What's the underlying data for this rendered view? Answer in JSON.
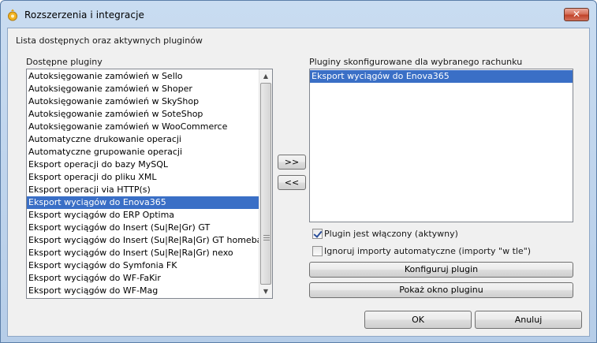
{
  "window": {
    "title": "Rozszerzenia i integracje",
    "close_symbol": "✕"
  },
  "header": {
    "description": "Lista dostępnych oraz aktywnych pluginów"
  },
  "available": {
    "label": "Dostępne pluginy",
    "items": [
      "Autoksięgowanie zamówień w Sello",
      "Autoksięgowanie zamówień w Shoper",
      "Autoksięgowanie zamówień w SkyShop",
      "Autoksięgowanie zamówień w SoteShop",
      "Autoksięgowanie zamówień w WooCommerce",
      "Automatyczne drukowanie operacji",
      "Automatyczne grupowanie operacji",
      "Eksport operacji do bazy MySQL",
      "Eksport operacji do pliku XML",
      "Eksport operacji via HTTP(s)",
      "Eksport wyciągów do Enova365",
      "Eksport wyciągów do ERP Optima",
      "Eksport wyciągów do Insert (Su|Re|Gr) GT",
      "Eksport wyciągów do Insert (Su|Re|Ra|Gr) GT homebanking",
      "Eksport wyciągów do Insert (Su|Re|Ra|Gr) nexo",
      "Eksport wyciągów do Symfonia FK",
      "Eksport wyciągów do WF-FaKir",
      "Eksport wyciągów do WF-Mag"
    ],
    "selected_index": 10
  },
  "configured": {
    "label": "Pluginy skonfigurowane dla wybranego rachunku",
    "items": [
      "Eksport wyciągów do Enova365"
    ],
    "selected_index": 0
  },
  "buttons": {
    "add": ">>",
    "remove": "<<",
    "configure": "Konfiguruj plugin",
    "show_window": "Pokaż okno pluginu",
    "ok": "OK",
    "cancel": "Anuluj"
  },
  "options": {
    "enabled_label": "Plugin jest włączony (aktywny)",
    "enabled_checked": true,
    "ignore_label": "Ignoruj importy automatyczne (importy \"w tle\")",
    "ignore_checked": false
  },
  "colors": {
    "selection": "#3a6fc6",
    "titlebar": "#c4d8f0",
    "close_button": "#c9533b"
  }
}
